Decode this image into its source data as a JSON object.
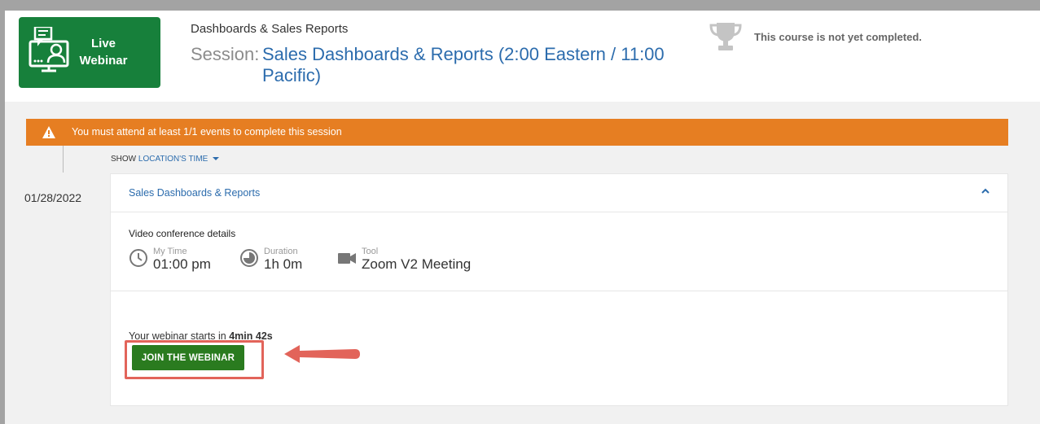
{
  "header": {
    "badge": {
      "line1": "Live",
      "line2": "Webinar",
      "icon": "webinar-computer-icon"
    },
    "course_title": "Dashboards & Sales Reports",
    "session_label": "Session:",
    "session_name": "Sales Dashboards & Reports (2:00 Eastern / 11:00 Pacific)",
    "completion_icon": "trophy-icon",
    "completion_text": "This course is not yet completed."
  },
  "warning": {
    "icon": "warning-icon",
    "text": "You must attend at least 1/1 events to complete this session"
  },
  "show_time": {
    "prefix": "SHOW",
    "link": "LOCATION'S TIME"
  },
  "event": {
    "date": "01/28/2022",
    "title": "Sales Dashboards & Reports",
    "details_label": "Video conference details",
    "details": [
      {
        "icon": "clock-icon",
        "label": "My Time",
        "value": "01:00 pm"
      },
      {
        "icon": "pie-icon",
        "label": "Duration",
        "value": "1h 0m"
      },
      {
        "icon": "video-camera-icon",
        "label": "Tool",
        "value": "Zoom V2 Meeting"
      }
    ],
    "starts_prefix": "Your webinar starts in",
    "starts_value": "4min 42s",
    "join_label": "JOIN THE WEBINAR"
  },
  "colors": {
    "brand_green": "#17803b",
    "warning_orange": "#e67e22",
    "link_blue": "#2c6cad",
    "button_green": "#2a7b1f",
    "annotation_red": "#e2645a"
  }
}
